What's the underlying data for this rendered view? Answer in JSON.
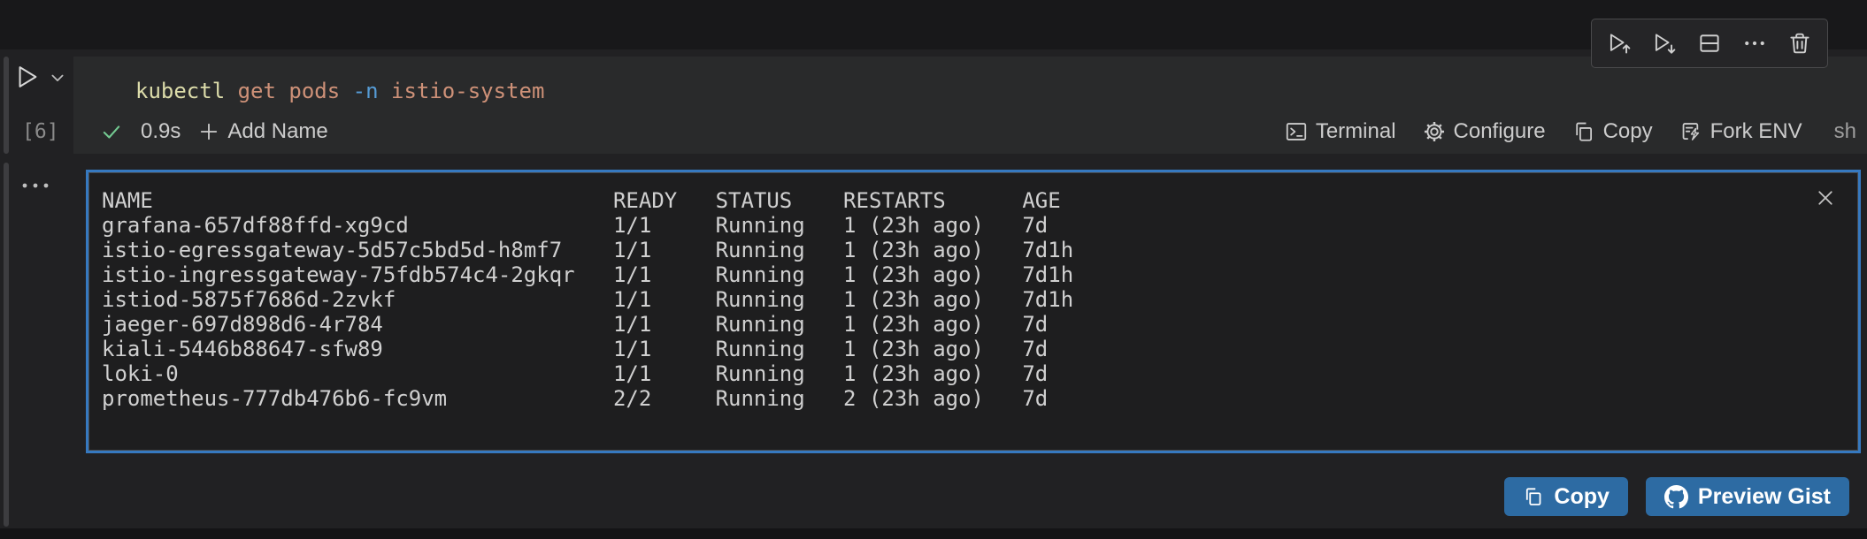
{
  "window": {
    "kind": "notebook-shell-cell",
    "language_id": "sh"
  },
  "cell": {
    "execution_count": "[6]",
    "command_tokens": [
      {
        "text": "kubectl ",
        "color": "#dcdcaa"
      },
      {
        "text": "get pods ",
        "color": "#ce9178"
      },
      {
        "text": "-n ",
        "color": "#569cd6"
      },
      {
        "text": "istio-system",
        "color": "#ce9178"
      }
    ],
    "status": {
      "duration": "0.9s",
      "add_name_label": "Add Name"
    },
    "actions": {
      "terminal_label": "Terminal",
      "configure_label": "Configure",
      "copy_label": "Copy",
      "fork_env_label": "Fork ENV",
      "language_label": "sh"
    }
  },
  "toolbar_icons": [
    "execute-above-icon",
    "execute-cell-and-below-icon",
    "split-cell-icon",
    "more-actions-icon",
    "delete-cell-icon"
  ],
  "output": {
    "columns": [
      "NAME",
      "READY",
      "STATUS",
      "RESTARTS",
      "AGE"
    ],
    "col_pad": {
      "name": 40,
      "ready": 8,
      "status": 10,
      "restarts": 14
    },
    "rows": [
      {
        "name": "grafana-657df88ffd-xg9cd",
        "ready": "1/1",
        "status": "Running",
        "restarts": "1 (23h ago)",
        "age": "7d"
      },
      {
        "name": "istio-egressgateway-5d57c5bd5d-h8mf7",
        "ready": "1/1",
        "status": "Running",
        "restarts": "1 (23h ago)",
        "age": "7d1h"
      },
      {
        "name": "istio-ingressgateway-75fdb574c4-2gkqr",
        "ready": "1/1",
        "status": "Running",
        "restarts": "1 (23h ago)",
        "age": "7d1h"
      },
      {
        "name": "istiod-5875f7686d-2zvkf",
        "ready": "1/1",
        "status": "Running",
        "restarts": "1 (23h ago)",
        "age": "7d1h"
      },
      {
        "name": "jaeger-697d898d6-4r784",
        "ready": "1/1",
        "status": "Running",
        "restarts": "1 (23h ago)",
        "age": "7d"
      },
      {
        "name": "kiali-5446b88647-sfw89",
        "ready": "1/1",
        "status": "Running",
        "restarts": "1 (23h ago)",
        "age": "7d"
      },
      {
        "name": "loki-0",
        "ready": "1/1",
        "status": "Running",
        "restarts": "1 (23h ago)",
        "age": "7d"
      },
      {
        "name": "prometheus-777db476b6-fc9vm",
        "ready": "2/2",
        "status": "Running",
        "restarts": "2 (23h ago)",
        "age": "7d"
      }
    ]
  },
  "footer": {
    "copy_label": "Copy",
    "preview_gist_label": "Preview Gist"
  },
  "colors": {
    "focus_border": "#3679c0",
    "button_bg": "#2d6ba3",
    "success_green": "#73c991",
    "cell_bg": "#292a2b",
    "output_bg": "#1e1e1f",
    "token_command": "#dcdcaa",
    "token_string": "#ce9178",
    "token_flag": "#569cd6"
  }
}
